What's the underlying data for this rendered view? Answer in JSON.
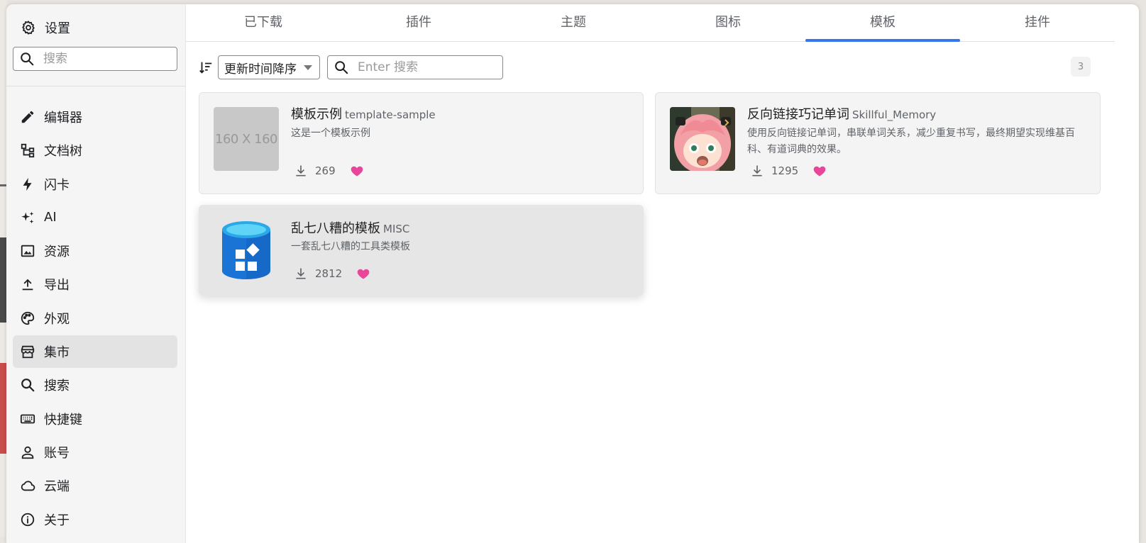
{
  "sidebar": {
    "title": "设置",
    "search_placeholder": "搜索",
    "items": [
      {
        "label": "编辑器",
        "icon": "pencil-icon"
      },
      {
        "label": "文档树",
        "icon": "tree-icon"
      },
      {
        "label": "闪卡",
        "icon": "flash-icon"
      },
      {
        "label": "AI",
        "icon": "sparkle-icon"
      },
      {
        "label": "资源",
        "icon": "image-icon"
      },
      {
        "label": "导出",
        "icon": "upload-icon"
      },
      {
        "label": "外观",
        "icon": "palette-icon"
      },
      {
        "label": "集市",
        "icon": "store-icon",
        "active": true
      },
      {
        "label": "搜索",
        "icon": "search-icon"
      },
      {
        "label": "快捷键",
        "icon": "keyboard-icon"
      },
      {
        "label": "账号",
        "icon": "account-icon"
      },
      {
        "label": "云端",
        "icon": "cloud-icon"
      },
      {
        "label": "关于",
        "icon": "info-icon"
      }
    ]
  },
  "tabs": [
    {
      "label": "已下载"
    },
    {
      "label": "插件"
    },
    {
      "label": "主题"
    },
    {
      "label": "图标"
    },
    {
      "label": "模板",
      "active": true
    },
    {
      "label": "挂件"
    }
  ],
  "toolbar": {
    "sort_value": "更新时间降序",
    "search_placeholder": "Enter 搜索",
    "count": "3"
  },
  "cards": [
    {
      "title": "模板示例",
      "slug": "template-sample",
      "description": "这是一个模板示例",
      "downloads": "269",
      "thumb_text": "160 X 160"
    },
    {
      "title": "反向链接巧记单词",
      "slug": "Skillful_Memory",
      "description": "使用反向链接记单词，串联单词关系，减少重复书写，最终期望实现维基百科、有道词典的效果。",
      "downloads": "1295"
    },
    {
      "title": "乱七八糟的模板",
      "slug": "MISC",
      "description": "一套乱七八糟的工具类模板",
      "downloads": "2812"
    }
  ],
  "colors": {
    "accent": "#3575f0",
    "heart": "#e9459a",
    "active_bg": "#e3e3e3"
  }
}
